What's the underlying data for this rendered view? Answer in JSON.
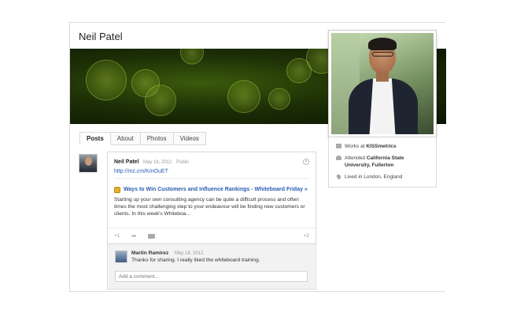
{
  "profile": {
    "name": "Neil Patel"
  },
  "tabs": [
    {
      "label": "Posts",
      "active": true
    },
    {
      "label": "About"
    },
    {
      "label": "Photos"
    },
    {
      "label": "Videos"
    }
  ],
  "post": {
    "author": "Neil Patel",
    "date": "May 18, 2012",
    "visibility": "Public",
    "link": "http://mz.cm/KmOuET",
    "share_title": "Ways to Win Customers and Influence Rankings - Whiteboard Friday »",
    "share_body": "Starting up your own consulting agency can be quite a difficult process and often times the most challenging step to your endeavour will be finding new customers or clients. In this week's Whiteboa...",
    "plus_one": "+1",
    "plus_count": "+2"
  },
  "comment": {
    "author": "Martin Ramirez",
    "date": "May 18, 2012",
    "text": "Thanks for sharing. I really liked the whiteboard training.",
    "input_placeholder": "Add a comment..."
  },
  "about": {
    "work_prefix": "Works at",
    "work_company": "KISSmetrics",
    "edu_prefix": "Attended",
    "edu_school_line1": "California State",
    "edu_school_line2": "University, Fullerton",
    "home": "Lived in London, England"
  },
  "colors": {
    "link_blue": "#2a5db0",
    "cover_green": "#1d3006"
  },
  "icons": {
    "caret": "chevron-down-icon",
    "share_arrow": "share-arrow-icon",
    "hangout": "hangout-icon",
    "work": "briefcase-icon",
    "education": "graduation-cap-icon",
    "home": "location-pin-icon"
  }
}
